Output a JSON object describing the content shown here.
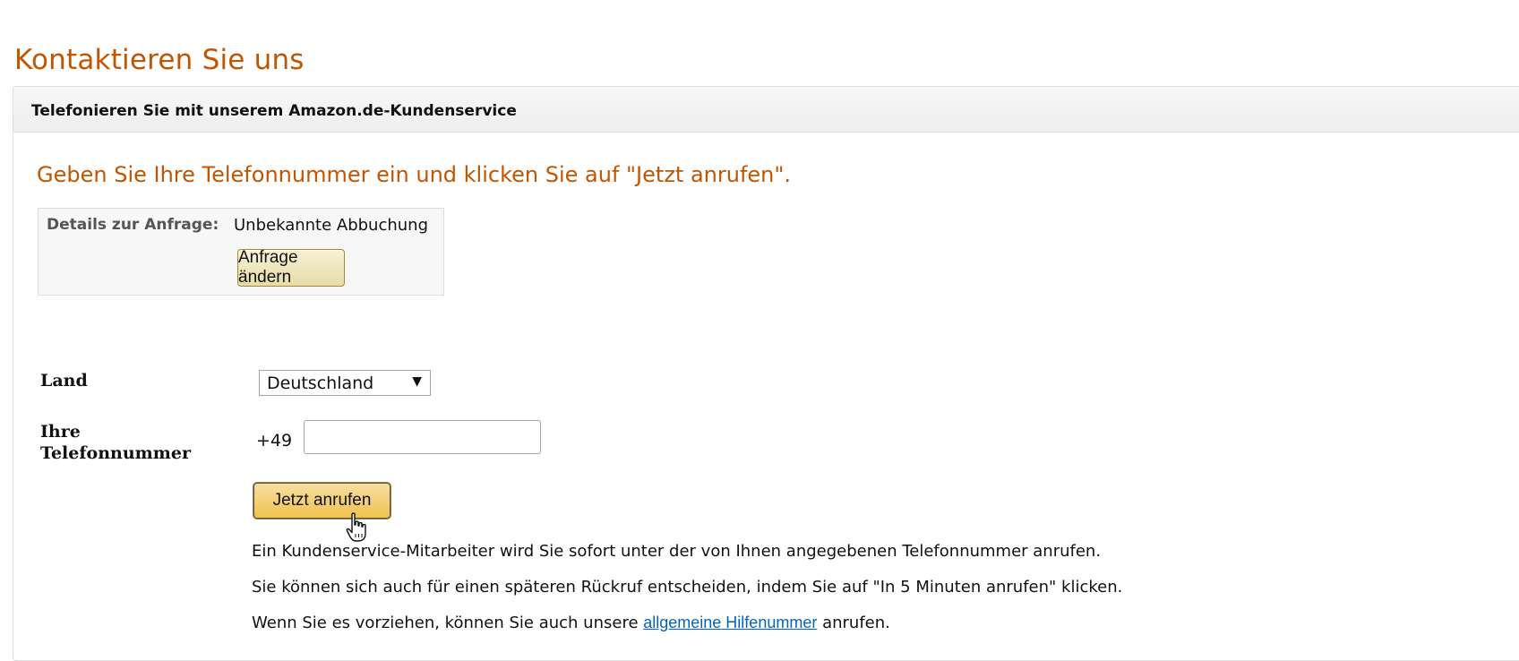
{
  "page": {
    "title": "Kontaktieren Sie uns"
  },
  "panel": {
    "header": "Telefonieren Sie mit unserem Amazon.de-Kundenservice",
    "subtitle": "Geben Sie Ihre Telefonnummer ein und klicken Sie auf \"Jetzt anrufen\"."
  },
  "details": {
    "label": "Details zur Anfrage:",
    "value": "Unbekannte Abbuchung",
    "change_button": "Anfrage ändern"
  },
  "form": {
    "country_label": "Land",
    "country_value": "Deutschland",
    "phone_label_line1": "Ihre",
    "phone_label_line2": "Telefonnummer",
    "phone_prefix": "+49",
    "phone_value": "",
    "call_button": "Jetzt anrufen"
  },
  "info": {
    "line1": "Ein Kundenservice-Mitarbeiter wird Sie sofort unter der von Ihnen angegebenen Telefonnummer anrufen.",
    "line2": "Sie können sich auch für einen späteren Rückruf entscheiden, indem Sie auf \"In 5 Minuten anrufen\" klicken.",
    "line3_before": "Wenn Sie es vorziehen, können Sie auch unsere ",
    "line3_link": "allgemeine Hilfenummer",
    "line3_after": " anrufen."
  },
  "colors": {
    "title_orange": "#c45500",
    "link_blue": "#0066c0",
    "call_button_yellow": "#f0c14b",
    "panel_border": "#dddddd"
  },
  "icons": {
    "select_arrow": "chevron-down-icon",
    "cursor": "hand-cursor-icon"
  }
}
